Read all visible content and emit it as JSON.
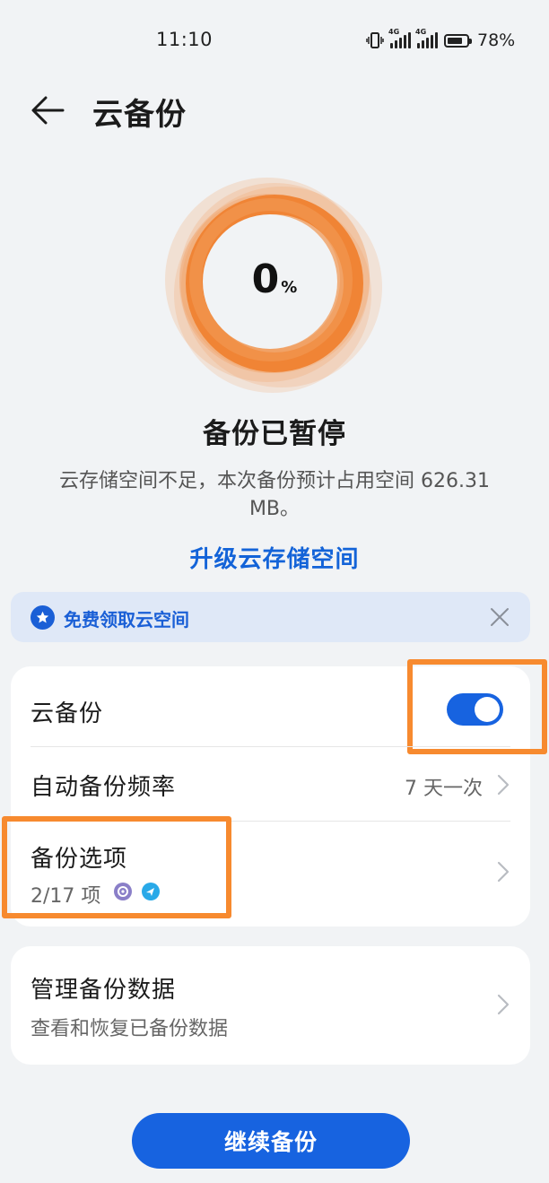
{
  "status_bar": {
    "time": "11:10",
    "network_1": "4G",
    "network_2": "4G",
    "battery_level": 0.78,
    "battery_percent": "78%"
  },
  "header": {
    "back_icon": "arrow-left-icon",
    "title": "云备份"
  },
  "progress": {
    "value": "0",
    "unit": "%",
    "ring_color": "#f28a3c"
  },
  "status": {
    "title": "备份已暂停",
    "description": "云存储空间不足，本次备份预计占用空间 626.31 MB。",
    "upgrade_link": "升级云存储空间"
  },
  "promo": {
    "icon": "star-badge-icon",
    "text": "免费领取云空间",
    "close_icon": "close-icon"
  },
  "settings": {
    "cloud_backup_label": "云备份",
    "cloud_backup_enabled": true,
    "frequency_label": "自动备份频率",
    "frequency_value": "7 天一次",
    "options_label": "备份选项",
    "options_count": "2/17 项",
    "option_app_icons": [
      "settings-gear-app-icon",
      "blue-bird-app-icon"
    ]
  },
  "manage": {
    "label": "管理备份数据",
    "sub": "查看和恢复已备份数据"
  },
  "actions": {
    "continue_label": "继续备份"
  },
  "colors": {
    "accent": "#1763e0",
    "highlight": "#f78a2f",
    "background": "#f1f3f5"
  }
}
